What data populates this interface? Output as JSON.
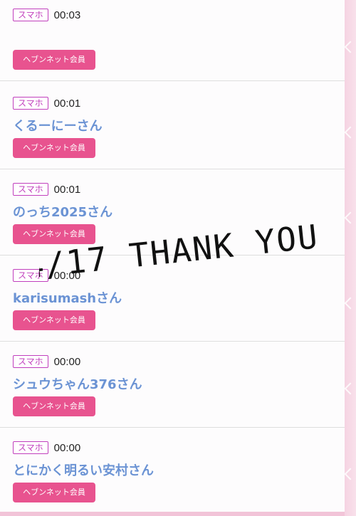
{
  "entries": [
    {
      "device": "スマホ",
      "time": "00:03",
      "name": "",
      "member_label": "ヘブンネット会員"
    },
    {
      "device": "スマホ",
      "time": "00:01",
      "name": "くるーにーさん",
      "member_label": "ヘブンネット会員"
    },
    {
      "device": "スマホ",
      "time": "00:01",
      "name": "のっち2025さん",
      "member_label": "ヘブンネット会員"
    },
    {
      "device": "スマホ",
      "time": "00:00",
      "name": "karisumashさん",
      "member_label": "ヘブンネット会員"
    },
    {
      "device": "スマホ",
      "time": "00:00",
      "name": "シュウちゃん376さん",
      "member_label": "ヘブンネット会員"
    },
    {
      "device": "スマホ",
      "time": "00:00",
      "name": "とにかく明るい安村さん",
      "member_label": "ヘブンネット会員"
    }
  ],
  "overlay_text": "4/17 THANK YOU!",
  "colors": {
    "badge": "#c13fbd",
    "name": "#6b93d4",
    "member_button": "#e8538f",
    "side_strip": "#f6d3e2"
  }
}
